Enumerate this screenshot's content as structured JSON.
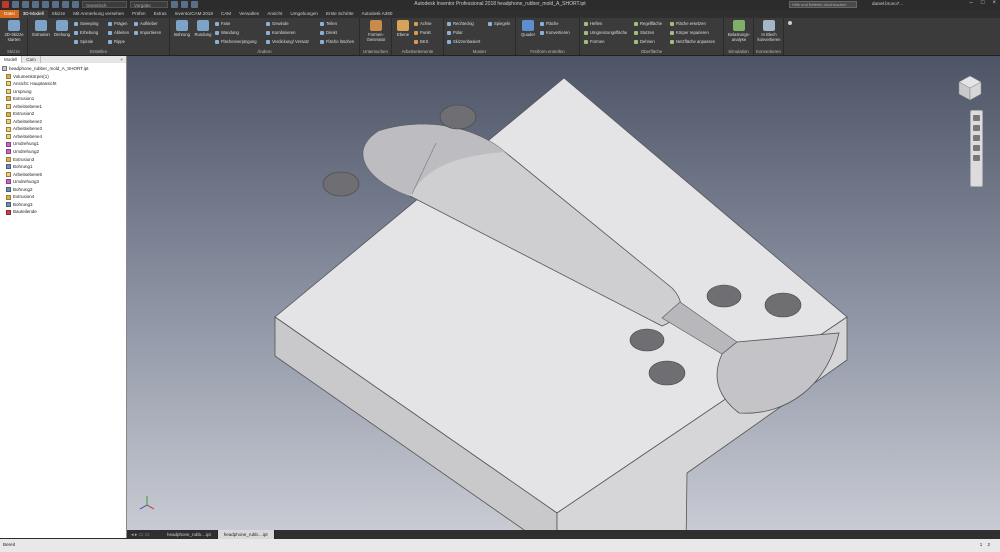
{
  "titlebar": {
    "app_title": "Autodesk Inventor Professional 2018   headphone_rubber_mold_A_SHORT.ipt",
    "material": "Generisch",
    "appearance": "Vorgabe",
    "search_placeholder": "Hilfe und Befehle durchsuchen",
    "user": "daniel.bruno7..."
  },
  "tabs": [
    "Datei",
    "3D-Modell",
    "Skizze",
    "Mit Anmerkung versehen",
    "Prüfen",
    "Extras",
    "InventorCAM 2018",
    "CAM",
    "Verwalten",
    "Ansicht",
    "Umgebungen",
    "Erste Schritte",
    "Autodesk A360"
  ],
  "ribbon": {
    "skizze": {
      "label": "Skizze",
      "btn": "2D-Skizze starten"
    },
    "erstellen": {
      "label": "Erstellen",
      "extrusion": "Extrusion",
      "drehung": "Drehung",
      "sweeping": "Sweeping",
      "erhebung": "Erhebung",
      "spirale": "Spirale",
      "prägen": "Prägen",
      "ableiten": "Ableiten",
      "rippe": "Rippe",
      "aufkleber": "Aufkleber",
      "importieren": "Importieren"
    },
    "aendern": {
      "label": "Ändern",
      "bohrung": "Bohrung",
      "rundung": "Rundung",
      "fase": "Fase",
      "wandung": "Wandung",
      "flaechenverjuengung": "Flächenverjüngung",
      "gewinde": "Gewinde",
      "kombinieren": "Kombinieren",
      "verdickung": "Verdickung/ Versatz",
      "teilen": "Teilen",
      "direkt": "Direkt",
      "flaeche_loeschen": "Fläche löschen"
    },
    "untersuchen": {
      "label": "Untersuchen",
      "formen_generator": "Formen-Generator"
    },
    "arbeitselemente": {
      "label": "Arbeitselemente",
      "ebene": "Ebene",
      "achse": "Achse",
      "punkt": "Punkt",
      "bks": "BKS"
    },
    "muster": {
      "label": "Muster",
      "rechteckig": "Rechteckig",
      "polar": "Polar",
      "skizzenbasiert": "Skizzenbasiert",
      "spiegeln": "Spiegeln"
    },
    "freiform": {
      "label": "Freiform erstellen",
      "quader": "Quader",
      "flaeche": "Fläche",
      "konvertieren": "Konvertieren"
    },
    "oberflaeche": {
      "label": "Oberfläche",
      "heften": "Heften",
      "umgrenzung": "Umgrenzungsfläche",
      "formen": "Formen",
      "regelflaeche": "Regelfläche",
      "stutzen": "Stutzen",
      "dehnen": "Dehnen",
      "flaeche_ersetzen": "Fläche ersetzen",
      "koerper_reparieren": "Körper reparieren",
      "netzflaeche": "Netzfläche anpassen"
    },
    "simulation": {
      "label": "Simulation",
      "btn": "Belastungs-analyse"
    },
    "konvertieren": {
      "label": "Konvertieren",
      "btn": "In Blech konvertieren"
    }
  },
  "browser": {
    "tabs": [
      "Modell",
      "Cam"
    ],
    "nodes": [
      {
        "label": "headphone_rubber_mold_A_SHORT.ipt",
        "type": "root",
        "indent": 0
      },
      {
        "label": "Volumenkörper(1)",
        "type": "feat",
        "indent": 1
      },
      {
        "label": "Ansicht: Hauptansicht",
        "type": "plane",
        "indent": 1
      },
      {
        "label": "Ursprung",
        "type": "plane",
        "indent": 1
      },
      {
        "label": "Extrusion1",
        "type": "feat",
        "indent": 1
      },
      {
        "label": "Arbeitsebene1",
        "type": "plane",
        "indent": 1
      },
      {
        "label": "Extrusion2",
        "type": "feat",
        "indent": 1
      },
      {
        "label": "Arbeitsebene2",
        "type": "plane",
        "indent": 1
      },
      {
        "label": "Arbeitsebene3",
        "type": "plane",
        "indent": 1
      },
      {
        "label": "Arbeitsebene4",
        "type": "plane",
        "indent": 1
      },
      {
        "label": "Umdrehung1",
        "type": "rev",
        "indent": 1
      },
      {
        "label": "Umdrehung2",
        "type": "rev",
        "indent": 1
      },
      {
        "label": "Extrusion3",
        "type": "feat",
        "indent": 1
      },
      {
        "label": "Bohrung1",
        "type": "hole",
        "indent": 1
      },
      {
        "label": "Arbeitsebene5",
        "type": "plane",
        "indent": 1
      },
      {
        "label": "Umdrehung3",
        "type": "rev",
        "indent": 1
      },
      {
        "label": "Bohrung2",
        "type": "hole",
        "indent": 1
      },
      {
        "label": "Extrusion4",
        "type": "feat",
        "indent": 1
      },
      {
        "label": "Bohrung3",
        "type": "hole",
        "indent": 1
      },
      {
        "label": "Bauteilende",
        "type": "end",
        "indent": 1
      }
    ]
  },
  "doctabs": [
    "headphone_rubb....ipt",
    "headphone_rubb....ipt"
  ],
  "status": {
    "text": "Bereit",
    "page1": "1",
    "page2": "2"
  }
}
